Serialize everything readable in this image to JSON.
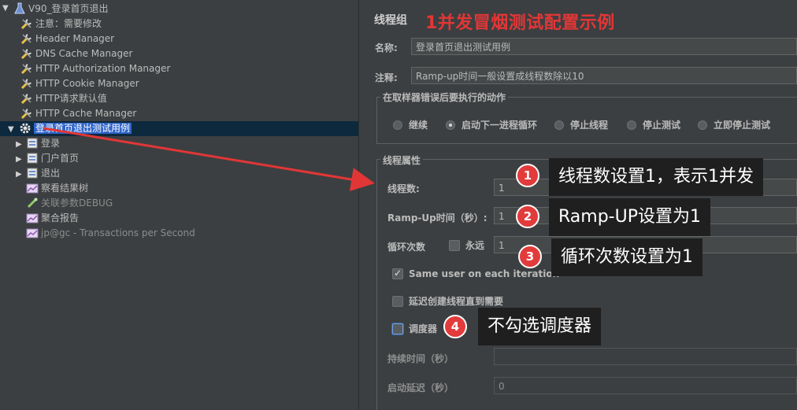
{
  "tree": {
    "items": [
      {
        "label": "V90_登录首页退出",
        "icon": "flask-icon"
      },
      {
        "label": "注意：需要修改",
        "icon": "wrench-icon"
      },
      {
        "label": "Header Manager",
        "icon": "wrench-icon"
      },
      {
        "label": "DNS Cache Manager",
        "icon": "wrench-icon"
      },
      {
        "label": "HTTP Authorization Manager",
        "icon": "wrench-icon"
      },
      {
        "label": "HTTP Cookie Manager",
        "icon": "wrench-icon"
      },
      {
        "label": "HTTP请求默认值",
        "icon": "wrench-icon"
      },
      {
        "label": "HTTP Cache Manager",
        "icon": "wrench-icon"
      },
      {
        "label": "登录首页退出测试用例",
        "icon": "gear-icon"
      },
      {
        "label": "登录",
        "icon": "controller-icon"
      },
      {
        "label": "门户首页",
        "icon": "controller-icon"
      },
      {
        "label": "退出",
        "icon": "controller-icon"
      },
      {
        "label": "察看结果树",
        "icon": "graph-icon"
      },
      {
        "label": "关联参数DEBUG",
        "icon": "debug-icon"
      },
      {
        "label": "聚合报告",
        "icon": "graph-icon"
      },
      {
        "label": "jp@gc - Transactions per Second",
        "icon": "graph-icon"
      }
    ]
  },
  "panel": {
    "title": "线程组",
    "annotation_title": "1并发冒烟测试配置示例",
    "name_label": "名称:",
    "name_value": "登录首页退出测试用例",
    "comment_label": "注释:",
    "comment_value": "Ramp-up时间一般设置成线程数除以10",
    "error_group": {
      "legend": "在取样器错误后要执行的动作",
      "options": [
        "继续",
        "启动下一进程循环",
        "停止线程",
        "停止测试",
        "立即停止测试"
      ],
      "selected": "启动下一进程循环"
    },
    "thread_group": {
      "legend": "线程属性",
      "threads_label": "线程数:",
      "threads_value": "1",
      "ramp_label": "Ramp-Up时间（秒）:",
      "ramp_value": "1",
      "loop_label": "循环次数",
      "forever_label": "永远",
      "forever_checked": false,
      "loop_value": "1",
      "same_user_label": "Same user on each iteration",
      "same_user_checked": true,
      "delay_label": "延迟创建线程直到需要",
      "delay_checked": false,
      "scheduler_label": "调度器",
      "scheduler_checked": false,
      "duration_label": "持续时间（秒）",
      "duration_value": "",
      "startup_label": "启动延迟（秒）",
      "startup_value": "0"
    }
  },
  "annotations": [
    {
      "num": "1",
      "text": "线程数设置1，表示1并发"
    },
    {
      "num": "2",
      "text": "Ramp-UP设置为1"
    },
    {
      "num": "3",
      "text": "循环次数设置为1"
    },
    {
      "num": "4",
      "text": "不勾选调度器"
    }
  ],
  "colors": {
    "accent_red": "#e23636",
    "selection": "#2f65ca",
    "background": "#3c3f41"
  }
}
